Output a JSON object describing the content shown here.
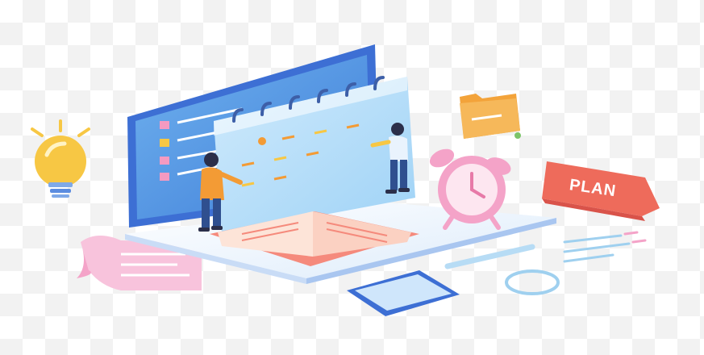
{
  "illustration": {
    "plan_label": "PLAN"
  },
  "colors": {
    "screen_frame": "#3d6fd4",
    "screen_panel": "#5fa3e8",
    "calendar": "#bfe3fb",
    "base_plate": "#e9f3fd",
    "person_shirt": "#f39b35",
    "person_pants": "#2f4f8f",
    "bulb": "#f7c744",
    "clock": "#f4a3c8",
    "plan_tag": "#ee6b5b",
    "folder": "#f3a33a",
    "paper_roll": "#f8c3dc",
    "book": "#f58a7c"
  }
}
